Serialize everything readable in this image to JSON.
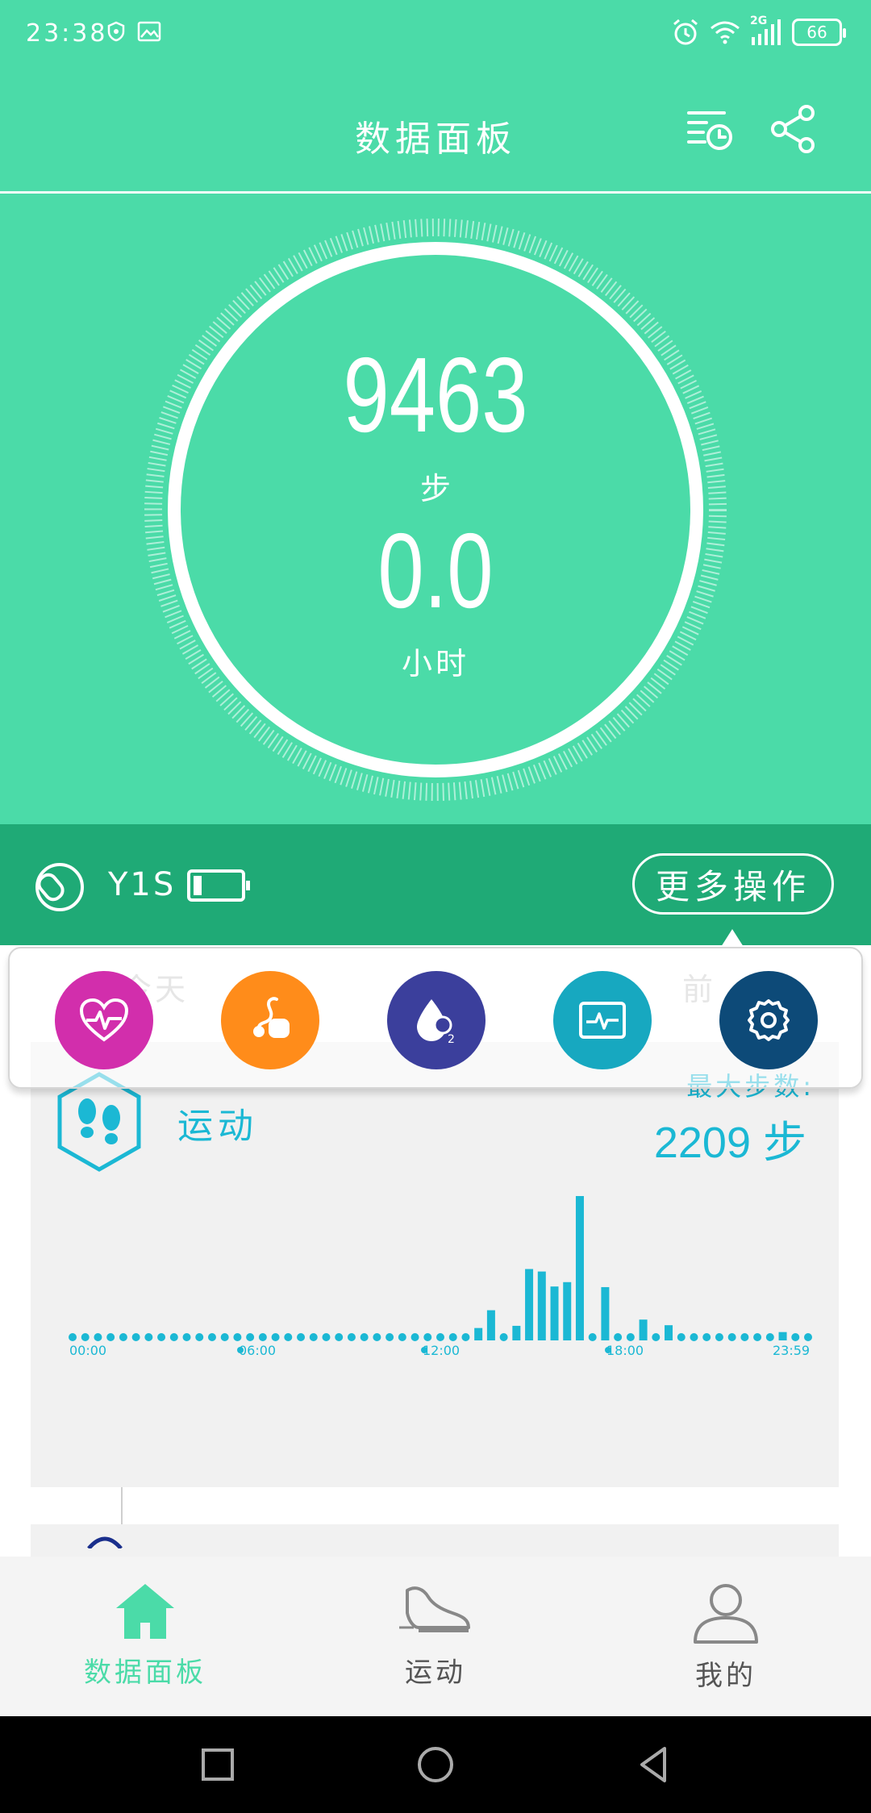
{
  "status_bar": {
    "time": "23:38",
    "network": "2G",
    "battery": "66"
  },
  "header": {
    "title": "数据面板"
  },
  "summary": {
    "steps": "9463",
    "steps_unit": "步",
    "hours": "0.0",
    "hours_unit": "小时"
  },
  "device": {
    "name": "Y1S",
    "more_label": "更多操作"
  },
  "actions": [
    {
      "icon": "heart-rate-icon",
      "color": "#d22eac"
    },
    {
      "icon": "blood-pressure-icon",
      "color": "#ff8c1a"
    },
    {
      "icon": "blood-oxygen-icon",
      "color": "#3b3f9c"
    },
    {
      "icon": "ecg-icon",
      "color": "#17a8c0"
    },
    {
      "icon": "settings-icon",
      "color": "#0d4a78"
    }
  ],
  "day_nav": {
    "today": "今天",
    "prev": "前"
  },
  "activity_card": {
    "title": "运动",
    "max_label": "最大步数:",
    "max_value": "2209 步"
  },
  "chart_data": {
    "type": "bar",
    "x_ticks": [
      "00:00",
      "06:00",
      "12:00",
      "18:00",
      "23:59"
    ],
    "ylim": [
      0,
      2209
    ],
    "values": [
      0,
      0,
      0,
      0,
      0,
      0,
      0,
      0,
      0,
      0,
      0,
      0,
      0,
      0,
      0,
      0,
      0,
      0,
      0,
      0,
      0,
      0,
      0,
      0,
      0,
      0,
      0,
      0,
      0,
      0,
      0,
      0,
      95,
      380,
      0,
      130,
      1040,
      1000,
      760,
      830,
      2209,
      0,
      750,
      0,
      0,
      230,
      0,
      140,
      0,
      0,
      0,
      0,
      0,
      0,
      0,
      0,
      30,
      0,
      0
    ],
    "color": "#1bb8d4"
  },
  "tabs": [
    {
      "label": "数据面板",
      "icon": "home-icon",
      "active": true
    },
    {
      "label": "运动",
      "icon": "shoe-icon",
      "active": false
    },
    {
      "label": "我的",
      "icon": "profile-icon",
      "active": false
    }
  ],
  "colors": {
    "primary": "#4bdba8",
    "primary_dark": "#1faa76",
    "accent": "#1bb8d4"
  }
}
